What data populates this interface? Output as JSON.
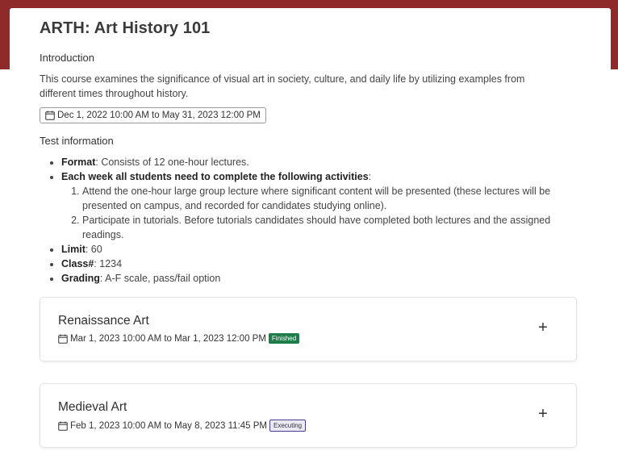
{
  "course": {
    "title": "ARTH: Art History 101",
    "intro_heading": "Introduction",
    "intro_text": "This course examines the significance of visual art in society, culture, and daily life by utilizing examples from different times throughout history.",
    "date_range": "Dec 1, 2022 10:00 AM to May 31, 2023 12:00 PM"
  },
  "test_info": {
    "heading": "Test information",
    "format_label": "Format",
    "format_value": ": Consists of 12 one-hour lectures.",
    "activities_label": "Each week all students need to complete the following activities",
    "activities_colon": ":",
    "activities": [
      "Attend the one-hour large group lecture where significant content will be presented (these lectures will be presented on campus, and recorded for candidates studying online).",
      "Participate in tutorials. Before tutorials candidates should have completed both lectures and the assigned readings."
    ],
    "limit_label": "Limit",
    "limit_value": ": 60",
    "class_label": "Class#",
    "class_value": ": 1234",
    "grading_label": "Grading",
    "grading_value": ": A-F scale, pass/fail option"
  },
  "modules": [
    {
      "title": "Renaissance Art",
      "dates": "Mar 1, 2023 10:00 AM to Mar 1, 2023 12:00 PM",
      "status": "Finished",
      "status_color": "#1e7b4a",
      "expand_icon": "plus-icon",
      "expand_symbol": "+"
    },
    {
      "title": "Medieval Art",
      "dates": "Feb 1, 2023 10:00 AM to May 8, 2023 11:45 PM",
      "status": "Executing",
      "status_color": "#4a3b8c",
      "expand_icon": "plus-icon",
      "expand_symbol": "+"
    }
  ],
  "colors": {
    "banner": "#8e2a2a",
    "finished_badge": "#1e7b4a",
    "executing_badge_border": "#4a3b8c"
  }
}
